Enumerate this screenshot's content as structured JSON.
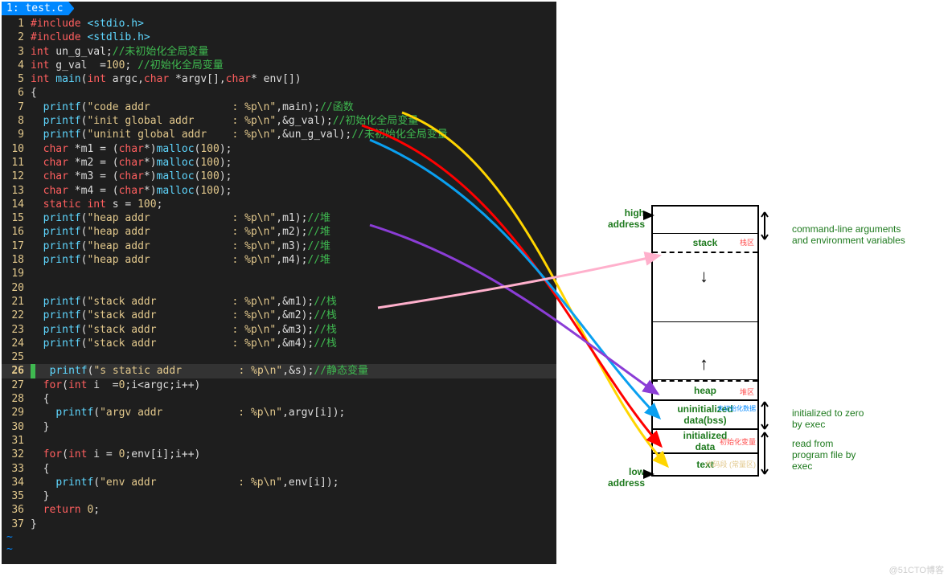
{
  "tab": "1: test.c",
  "code": [
    {
      "n": 1,
      "tokens": [
        [
          "pre",
          "#include "
        ],
        [
          "type",
          "<stdio.h>"
        ]
      ]
    },
    {
      "n": 2,
      "tokens": [
        [
          "pre",
          "#include "
        ],
        [
          "type",
          "<stdlib.h>"
        ]
      ]
    },
    {
      "n": 3,
      "tokens": [
        [
          "kw",
          "int"
        ],
        [
          "id",
          " un_g_val;"
        ],
        [
          "cmt",
          "//未初始化全局变量"
        ]
      ]
    },
    {
      "n": 4,
      "tokens": [
        [
          "kw",
          "int"
        ],
        [
          "id",
          " g_val  ="
        ],
        [
          "num",
          "100"
        ],
        [
          "id",
          "; "
        ],
        [
          "cmt",
          "//初始化全局变量"
        ]
      ]
    },
    {
      "n": 5,
      "tokens": [
        [
          "kw",
          "int"
        ],
        [
          "fn",
          " main"
        ],
        [
          "p",
          "("
        ],
        [
          "kw",
          "int"
        ],
        [
          "id",
          " argc,"
        ],
        [
          "kw",
          "char"
        ],
        [
          "id",
          " *argv[],"
        ],
        [
          "kw",
          "char"
        ],
        [
          "id",
          "* env[])"
        ]
      ]
    },
    {
      "n": 6,
      "tokens": [
        [
          "p",
          "{"
        ]
      ]
    },
    {
      "n": 7,
      "tokens": [
        [
          "id",
          "  "
        ],
        [
          "fn",
          "printf"
        ],
        [
          "p",
          "("
        ],
        [
          "str",
          "\"code addr             : %p\\n\""
        ],
        [
          "p",
          ",main);"
        ],
        [
          "cmt",
          "//函数"
        ]
      ]
    },
    {
      "n": 8,
      "tokens": [
        [
          "id",
          "  "
        ],
        [
          "fn",
          "printf"
        ],
        [
          "p",
          "("
        ],
        [
          "str",
          "\"init global addr      : %p\\n\""
        ],
        [
          "p",
          ",&g_val);"
        ],
        [
          "cmt",
          "//初始化全局变量"
        ]
      ]
    },
    {
      "n": 9,
      "tokens": [
        [
          "id",
          "  "
        ],
        [
          "fn",
          "printf"
        ],
        [
          "p",
          "("
        ],
        [
          "str",
          "\"uninit global addr    : %p\\n\""
        ],
        [
          "p",
          ",&un_g_val);"
        ],
        [
          "cmt",
          "//未初始化全局变量"
        ]
      ]
    },
    {
      "n": 10,
      "tokens": [
        [
          "id",
          "  "
        ],
        [
          "kw",
          "char"
        ],
        [
          "id",
          " *m1 = ("
        ],
        [
          "kw",
          "char"
        ],
        [
          "id",
          "*)"
        ],
        [
          "fn",
          "malloc"
        ],
        [
          "p",
          "("
        ],
        [
          "num",
          "100"
        ],
        [
          "p",
          ");"
        ]
      ]
    },
    {
      "n": 11,
      "tokens": [
        [
          "id",
          "  "
        ],
        [
          "kw",
          "char"
        ],
        [
          "id",
          " *m2 = ("
        ],
        [
          "kw",
          "char"
        ],
        [
          "id",
          "*)"
        ],
        [
          "fn",
          "malloc"
        ],
        [
          "p",
          "("
        ],
        [
          "num",
          "100"
        ],
        [
          "p",
          ");"
        ]
      ]
    },
    {
      "n": 12,
      "tokens": [
        [
          "id",
          "  "
        ],
        [
          "kw",
          "char"
        ],
        [
          "id",
          " *m3 = ("
        ],
        [
          "kw",
          "char"
        ],
        [
          "id",
          "*)"
        ],
        [
          "fn",
          "malloc"
        ],
        [
          "p",
          "("
        ],
        [
          "num",
          "100"
        ],
        [
          "p",
          ");"
        ]
      ]
    },
    {
      "n": 13,
      "tokens": [
        [
          "id",
          "  "
        ],
        [
          "kw",
          "char"
        ],
        [
          "id",
          " *m4 = ("
        ],
        [
          "kw",
          "char"
        ],
        [
          "id",
          "*)"
        ],
        [
          "fn",
          "malloc"
        ],
        [
          "p",
          "("
        ],
        [
          "num",
          "100"
        ],
        [
          "p",
          ");"
        ]
      ]
    },
    {
      "n": 14,
      "tokens": [
        [
          "id",
          "  "
        ],
        [
          "kw",
          "static int"
        ],
        [
          "id",
          " s = "
        ],
        [
          "num",
          "100"
        ],
        [
          "p",
          ";"
        ]
      ]
    },
    {
      "n": 15,
      "tokens": [
        [
          "id",
          "  "
        ],
        [
          "fn",
          "printf"
        ],
        [
          "p",
          "("
        ],
        [
          "str",
          "\"heap addr             : %p\\n\""
        ],
        [
          "p",
          ",m1);"
        ],
        [
          "cmt",
          "//堆"
        ]
      ]
    },
    {
      "n": 16,
      "tokens": [
        [
          "id",
          "  "
        ],
        [
          "fn",
          "printf"
        ],
        [
          "p",
          "("
        ],
        [
          "str",
          "\"heap addr             : %p\\n\""
        ],
        [
          "p",
          ",m2);"
        ],
        [
          "cmt",
          "//堆"
        ]
      ]
    },
    {
      "n": 17,
      "tokens": [
        [
          "id",
          "  "
        ],
        [
          "fn",
          "printf"
        ],
        [
          "p",
          "("
        ],
        [
          "str",
          "\"heap addr             : %p\\n\""
        ],
        [
          "p",
          ",m3);"
        ],
        [
          "cmt",
          "//堆"
        ]
      ]
    },
    {
      "n": 18,
      "tokens": [
        [
          "id",
          "  "
        ],
        [
          "fn",
          "printf"
        ],
        [
          "p",
          "("
        ],
        [
          "str",
          "\"heap addr             : %p\\n\""
        ],
        [
          "p",
          ",m4);"
        ],
        [
          "cmt",
          "//堆"
        ]
      ]
    },
    {
      "n": 19,
      "tokens": [
        [
          "id",
          ""
        ]
      ]
    },
    {
      "n": 20,
      "tokens": [
        [
          "id",
          ""
        ]
      ]
    },
    {
      "n": 21,
      "tokens": [
        [
          "id",
          "  "
        ],
        [
          "fn",
          "printf"
        ],
        [
          "p",
          "("
        ],
        [
          "str",
          "\"stack addr            : %p\\n\""
        ],
        [
          "p",
          ",&m1);"
        ],
        [
          "cmt",
          "//栈"
        ]
      ]
    },
    {
      "n": 22,
      "tokens": [
        [
          "id",
          "  "
        ],
        [
          "fn",
          "printf"
        ],
        [
          "p",
          "("
        ],
        [
          "str",
          "\"stack addr            : %p\\n\""
        ],
        [
          "p",
          ",&m2);"
        ],
        [
          "cmt",
          "//栈"
        ]
      ]
    },
    {
      "n": 23,
      "tokens": [
        [
          "id",
          "  "
        ],
        [
          "fn",
          "printf"
        ],
        [
          "p",
          "("
        ],
        [
          "str",
          "\"stack addr            : %p\\n\""
        ],
        [
          "p",
          ",&m3);"
        ],
        [
          "cmt",
          "//栈"
        ]
      ]
    },
    {
      "n": 24,
      "tokens": [
        [
          "id",
          "  "
        ],
        [
          "fn",
          "printf"
        ],
        [
          "p",
          "("
        ],
        [
          "str",
          "\"stack addr            : %p\\n\""
        ],
        [
          "p",
          ",&m4);"
        ],
        [
          "cmt",
          "//栈"
        ]
      ]
    },
    {
      "n": 25,
      "tokens": [
        [
          "id",
          ""
        ]
      ]
    },
    {
      "n": 26,
      "hl": true,
      "tokens": [
        [
          "id",
          "  "
        ],
        [
          "fn",
          "printf"
        ],
        [
          "p",
          "("
        ],
        [
          "str",
          "\"s static addr         : %p\\n\""
        ],
        [
          "p",
          ",&s);"
        ],
        [
          "cmt",
          "//静态变量"
        ]
      ]
    },
    {
      "n": 27,
      "tokens": [
        [
          "id",
          "  "
        ],
        [
          "kw",
          "for"
        ],
        [
          "p",
          "("
        ],
        [
          "kw",
          "int"
        ],
        [
          "id",
          " i  ="
        ],
        [
          "num",
          "0"
        ],
        [
          "p",
          ";i<argc;i++)"
        ]
      ]
    },
    {
      "n": 28,
      "tokens": [
        [
          "id",
          "  {"
        ]
      ]
    },
    {
      "n": 29,
      "tokens": [
        [
          "id",
          "    "
        ],
        [
          "fn",
          "printf"
        ],
        [
          "p",
          "("
        ],
        [
          "str",
          "\"argv addr            : %p\\n\""
        ],
        [
          "p",
          ",argv[i]);"
        ]
      ]
    },
    {
      "n": 30,
      "tokens": [
        [
          "id",
          "  }"
        ]
      ]
    },
    {
      "n": 31,
      "tokens": [
        [
          "id",
          ""
        ]
      ]
    },
    {
      "n": 32,
      "tokens": [
        [
          "id",
          "  "
        ],
        [
          "kw",
          "for"
        ],
        [
          "p",
          "("
        ],
        [
          "kw",
          "int"
        ],
        [
          "id",
          " i = "
        ],
        [
          "num",
          "0"
        ],
        [
          "p",
          ";env[i];i++)"
        ]
      ]
    },
    {
      "n": 33,
      "tokens": [
        [
          "id",
          "  {"
        ]
      ]
    },
    {
      "n": 34,
      "tokens": [
        [
          "id",
          "    "
        ],
        [
          "fn",
          "printf"
        ],
        [
          "p",
          "("
        ],
        [
          "str",
          "\"env addr             : %p\\n\""
        ],
        [
          "p",
          ",env[i]);"
        ]
      ]
    },
    {
      "n": 35,
      "tokens": [
        [
          "id",
          "  }"
        ]
      ]
    },
    {
      "n": 36,
      "tokens": [
        [
          "id",
          "  "
        ],
        [
          "kw",
          "return"
        ],
        [
          "id",
          " "
        ],
        [
          "num",
          "0"
        ],
        [
          "p",
          ";"
        ]
      ]
    },
    {
      "n": 37,
      "tokens": [
        [
          "p",
          "}"
        ]
      ]
    }
  ],
  "diagram": {
    "high": "high\naddress",
    "low": "low\naddress",
    "stack": "stack",
    "heap": "heap",
    "bss1": "uninitialized",
    "bss2": "data(bss)",
    "data1": "initialized",
    "data2": "data",
    "text": "text",
    "note_stack": "栈区",
    "note_heap": "堆区",
    "note_bss": "未初始化数据",
    "note_data": "初始化变量",
    "note_text": "代码段 (常量区)",
    "desc_cli": "command-line arguments\nand environment variables",
    "desc_bss": "initialized to zero\nby exec",
    "desc_data": "read from\nprogram file by\nexec"
  },
  "watermark": "@51CTO博客"
}
